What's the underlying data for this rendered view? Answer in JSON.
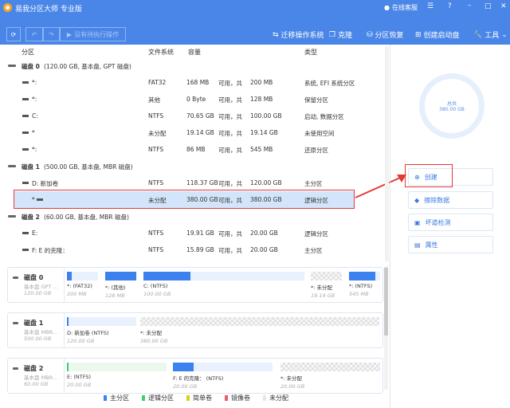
{
  "app": {
    "title": "易我分区大师 专业版",
    "online_service": "在线客服"
  },
  "toolbar": {
    "pending": "没有待执行操作",
    "migrate_os": "迁移操作系统",
    "clone": "克隆",
    "recovery": "分区恢复",
    "boot_disk": "创建启动盘",
    "tools": "工具"
  },
  "columns": {
    "partition": "分区",
    "fs": "文件系统",
    "capacity": "容量",
    "type": "类型"
  },
  "disks": [
    {
      "name": "磁盘 0",
      "info": "(120.00 GB, 基本盘, GPT 磁盘)",
      "partitions": [
        {
          "name": "*:",
          "fs": "FAT32",
          "free": "168 MB",
          "sep": "可用，共",
          "total": "200 MB",
          "type": "系统, EFI 系统分区"
        },
        {
          "name": "*:",
          "fs": "其他",
          "free": "0 Byte",
          "sep": "可用，共",
          "total": "128 MB",
          "type": "保留分区"
        },
        {
          "name": "C:",
          "fs": "NTFS",
          "free": "70.65 GB",
          "sep": "可用，共",
          "total": "100.00 GB",
          "type": "启动, 数据分区"
        },
        {
          "name": "*",
          "fs": "未分配",
          "free": "19.14 GB",
          "sep": "可用，共",
          "total": "19.14 GB",
          "type": "未使用空间"
        },
        {
          "name": "*:",
          "fs": "NTFS",
          "free": "86 MB",
          "sep": "可用，共",
          "total": "545 MB",
          "type": "还原分区"
        }
      ]
    },
    {
      "name": "磁盘 1",
      "info": "(500.00 GB, 基本盘, MBR 磁盘)",
      "partitions": [
        {
          "name": "D: 新加卷",
          "fs": "NTFS",
          "free": "118.37 GB",
          "sep": "可用，共",
          "total": "120.00 GB",
          "type": "主分区"
        },
        {
          "name": "*",
          "fs": "未分配",
          "free": "380.00 GB",
          "sep": "可用，共",
          "total": "380.00 GB",
          "type": "逻辑分区"
        }
      ]
    },
    {
      "name": "磁盘 2",
      "info": "(60.00 GB, 基本盘, MBR 磁盘)",
      "partitions": [
        {
          "name": "E:",
          "fs": "NTFS",
          "free": "19.91 GB",
          "sep": "可用，共",
          "total": "20.00 GB",
          "type": "逻辑分区"
        },
        {
          "name": "F: E 的克隆：",
          "fs": "NTFS",
          "free": "15.89 GB",
          "sep": "可用，共",
          "total": "20.00 GB",
          "type": "主分区"
        }
      ]
    }
  ],
  "maps": [
    {
      "name": "磁盘 0",
      "kind": "基本盘 GPT ...",
      "size": "120.00 GB",
      "segs": [
        {
          "label": "*:  (FAT32)",
          "size": "200 MB",
          "used": 0.16
        },
        {
          "label": "*:  (其他)",
          "size": "128 MB",
          "used": 1
        },
        {
          "label": "C:  (NTFS)",
          "size": "100.00 GB",
          "used": 0.29
        },
        {
          "label": "*: 未分配",
          "size": "19.14 GB",
          "used": null
        },
        {
          "label": "*:  (NTFS)",
          "size": "545 MB",
          "used": 0.84
        }
      ]
    },
    {
      "name": "磁盘 1",
      "kind": "基本盘 MBR...",
      "size": "500.00 GB",
      "segs": [
        {
          "label": "D: 新加卷 (NTFS)",
          "size": "120.00 GB",
          "used": 0.02
        },
        {
          "label": "*: 未分配",
          "size": "380.00 GB",
          "used": null
        }
      ]
    },
    {
      "name": "磁盘 2",
      "kind": "基本盘 MBR...",
      "size": "60.00 GB",
      "segs": [
        {
          "label": "E:  (NTFS)",
          "size": "20.00 GB",
          "used": 0.005
        },
        {
          "label": "F: E 的克隆：  (NTFS)",
          "size": "20.00 GB",
          "used": 0.21
        },
        {
          "label": "*: 未分配",
          "size": "20.00 GB",
          "used": null
        }
      ]
    }
  ],
  "legend": {
    "primary": "主分区",
    "logical": "逻辑分区",
    "simple": "简单卷",
    "mirror": "镜像卷",
    "unalloc": "未分配"
  },
  "summary": {
    "label": "总共",
    "total": "380.00 GB"
  },
  "actions": {
    "create": "创建",
    "wipe": "擦除数据",
    "surface": "坏道检测",
    "properties": "属性"
  },
  "colors": {
    "brand": "#4a86e8",
    "primary": "#3b82ee",
    "logical": "#3fcf6c",
    "simple": "#d4d41a",
    "mirror": "#ee5a6f",
    "highlight": "#e53935"
  }
}
